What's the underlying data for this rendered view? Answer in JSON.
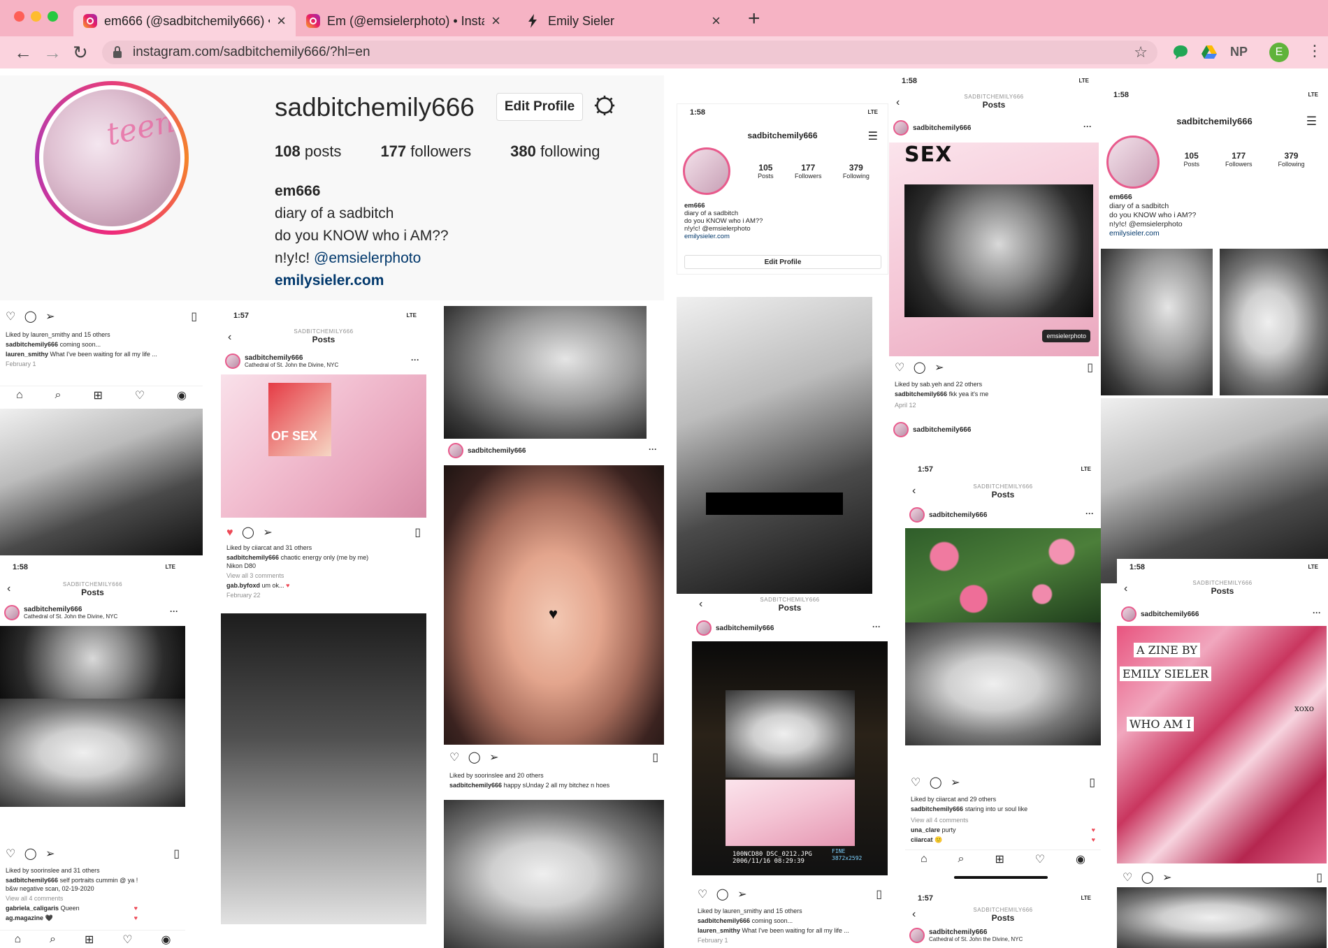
{
  "browser": {
    "tabs": [
      {
        "title": "em666 (@sadbitchemily666) •",
        "favicon": "instagram-icon",
        "active": true
      },
      {
        "title": "Em (@emsielerphoto) • Instagr",
        "favicon": "instagram-icon",
        "active": false
      },
      {
        "title": "Emily Sieler",
        "favicon": "bolt-icon",
        "active": false
      }
    ],
    "new_tab_symbol": "+",
    "close_symbol": "×",
    "url": "instagram.com/sadbitchemily666/?hl=en",
    "extension_np": "NP",
    "profile_initial": "E",
    "colors": {
      "tabbar": "#f6b3c4",
      "toolbar": "#fbd3de"
    }
  },
  "profile": {
    "username": "sadbitchemily666",
    "edit_profile": "Edit Profile",
    "posts": "108",
    "posts_label": "posts",
    "followers": "177",
    "followers_label": "followers",
    "following": "380",
    "following_label": "following",
    "name": "em666",
    "bio_line1": "diary of a sadbitch",
    "bio_line2": "do you KNOW who i AM??",
    "bio_line3_prefix": "n!y!c! ",
    "bio_mention": "@emsielerphoto",
    "website": "emilysieler.com"
  },
  "collage": {
    "posts_header": "Posts",
    "account_caps": "SADBITCHEMILY666",
    "user": "sadbitchemily666",
    "location": "Cathedral of St. John the Divine, NYC",
    "times": [
      "1:57",
      "1:58"
    ],
    "network": "LTE",
    "shot_a": {
      "liked": "Liked by lauren_smithy and 15 others",
      "caption_user": "sadbitchemily666",
      "caption": "coming soon...",
      "comment_user": "lauren_smithy",
      "comment": "What I've been waiting for all my life ...",
      "date": "February 1"
    },
    "shot_b": {
      "liked": "Liked by ciiarcat and 31 others",
      "caption": "chaotic energy only (me by me)",
      "camera": "Nikon D80",
      "view_all": "View all 3 comments",
      "comment_user": "gab.byfoxd",
      "comment": "um ok...",
      "date": "February 22"
    },
    "shot_c": {
      "liked": "Liked by soorinslee and 31 others",
      "caption": "self portraits cummin @ ya !",
      "caption2": "b&w negative scan, 02-19-2020",
      "view_all": "View all 4 comments",
      "c1_user": "gabriela_caligaris",
      "c1": "Queen",
      "c2_user": "ag.magazine",
      "c2": "🖤"
    },
    "shot_d": {
      "liked": "Liked by soorinslee and 20 others",
      "caption": "happy sUnday 2 all my bitchez n hoes"
    },
    "mini_profile": {
      "user": "sadbitchemily666",
      "posts": "105",
      "posts_label": "Posts",
      "followers": "177",
      "followers_label": "Followers",
      "following": "379",
      "following_label": "Following",
      "name": "em666",
      "bio1": "diary of a sadbitch",
      "bio2": "do you KNOW who i AM??",
      "bio3": "n!y!c! @emsielerphoto",
      "site": "emilysieler.com",
      "edit": "Edit Profile"
    },
    "shot_e": {
      "tag": "emsielerphoto",
      "sex_word": "SEX",
      "liked": "Liked by sab.yeh and 22 others",
      "caption": "fkk yea it's me",
      "date": "April 12"
    },
    "shot_f": {
      "liked": "Liked by ciiarcat and 29 others",
      "caption": "staring into ur soul like",
      "view_all": "View all 4 comments",
      "c1_user": "una_clare",
      "c1": "purty",
      "c2_user": "ciiarcat",
      "c2": "🙂"
    },
    "camera_readout": {
      "line1": "100NCD80  DSC_0212.JPG",
      "line2": "2006/11/16  08:29:39",
      "fine": "FINE",
      "size": "3872x2592"
    },
    "zine_words": [
      "A ZINE BY",
      "EMILY SIELER",
      "WHO AM I",
      "xoxo"
    ],
    "of_sex": "OF SEX"
  }
}
